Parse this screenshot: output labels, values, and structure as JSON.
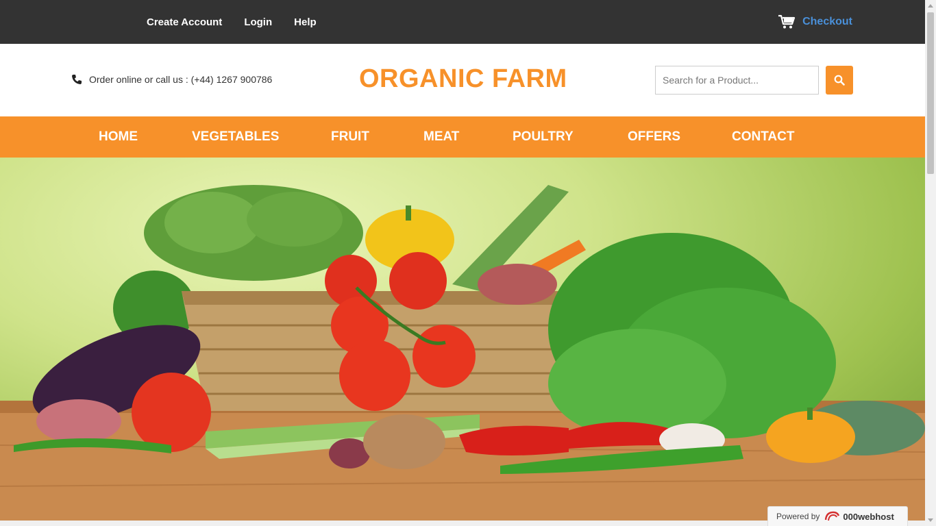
{
  "topbar": {
    "links": [
      "Create Account",
      "Login",
      "Help"
    ],
    "checkout_label": "Checkout"
  },
  "header": {
    "phone_text": "Order online or call us : (+44) 1267 900786",
    "brand": "ORGANIC FARM",
    "search_placeholder": "Search for a Product..."
  },
  "nav": {
    "items": [
      "HOME",
      "VEGETABLES",
      "FRUIT",
      "MEAT",
      "POULTRY",
      "OFFERS",
      "CONTACT"
    ]
  },
  "footer_badge": {
    "powered_by": "Powered by",
    "host": "000webhost"
  },
  "colors": {
    "accent": "#f7912a",
    "topbar": "#333333",
    "checkout_link": "#4a90d9"
  },
  "icons": {
    "cart": "shopping-cart-icon",
    "phone": "phone-icon",
    "search": "search-icon"
  }
}
